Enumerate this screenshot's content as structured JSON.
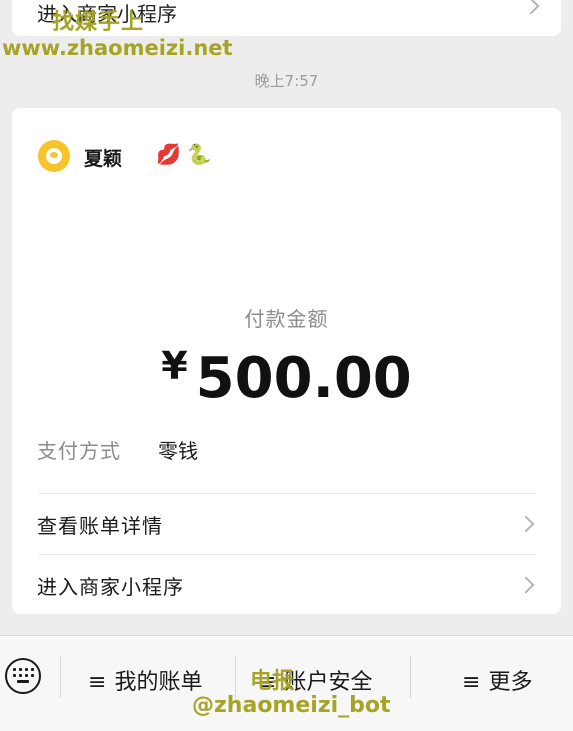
{
  "previous_card": {
    "mini_program_label": "进入商家小程序"
  },
  "watermark": {
    "line1": "找媒手上",
    "line2": "www.zhaomeizi.net",
    "line3": "电报",
    "line4": "@zhaomeizi_bot"
  },
  "timestamp": "晚上7:57",
  "payment_card": {
    "merchant_name": "夏颖",
    "merchant_emojis": "💋🐍",
    "amount_label": "付款金额",
    "currency_symbol": "¥",
    "amount": "500.00",
    "pay_method_label": "支付方式",
    "pay_method_value": "零钱",
    "view_bill_label": "查看账单详情",
    "mini_program_label": "进入商家小程序"
  },
  "bottom_menu": {
    "items": [
      {
        "label": "我的账单"
      },
      {
        "label": "账户安全"
      },
      {
        "label": "更多"
      }
    ],
    "menu_glyph": "≡"
  }
}
